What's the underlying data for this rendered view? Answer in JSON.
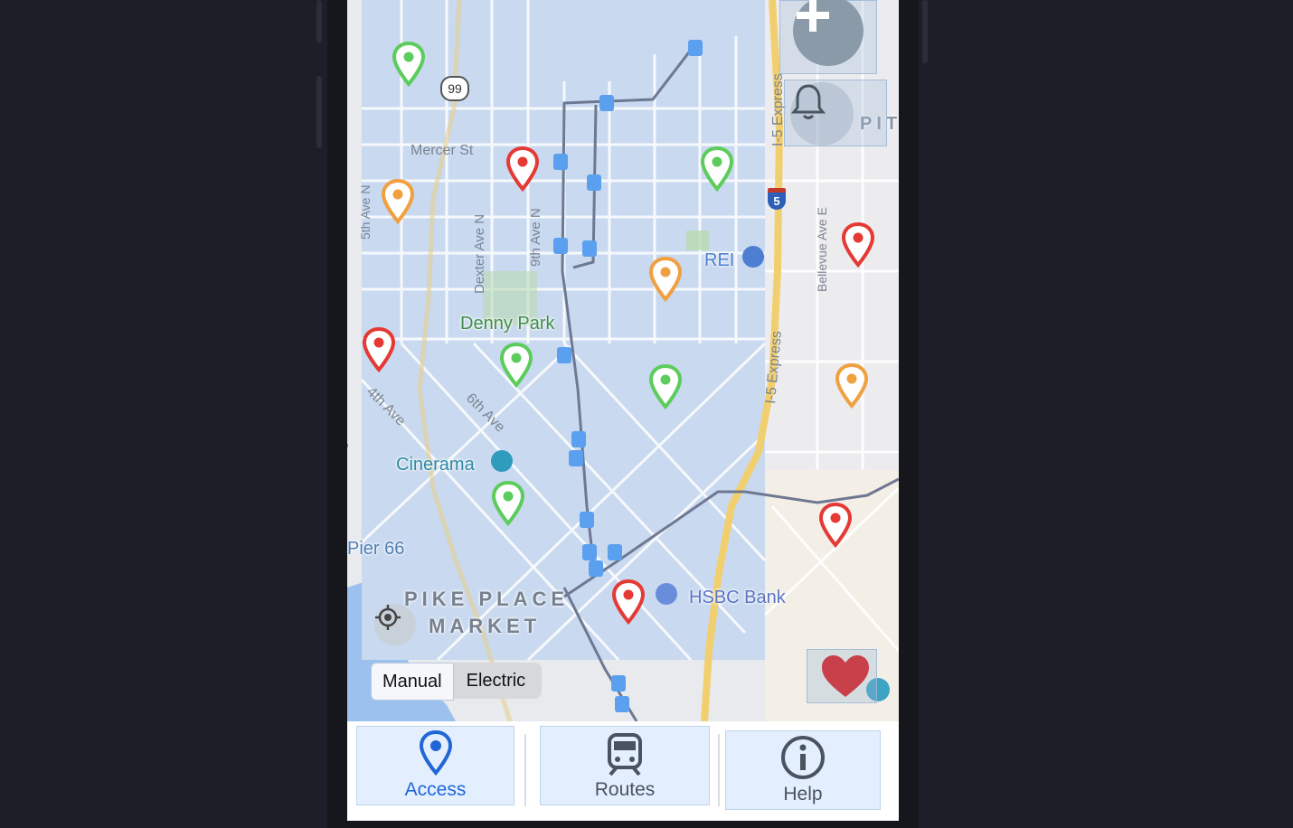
{
  "map": {
    "places": {
      "denny_park": "Denny Park",
      "rei": "REI",
      "cinerama": "Cinerama",
      "pier66": "Pier 66",
      "pike_place_line1": "PIKE PLACE",
      "pike_place_line2": "MARKET",
      "hsbc": "HSBC Bank",
      "pit": "PIT"
    },
    "streets": {
      "mercer": "Mercer St",
      "fifth_ave_n": "5th Ave N",
      "dexter": "Dexter Ave N",
      "ninth_ave_n": "9th Ave N",
      "bellevue": "Bellevue Ave E",
      "fourth_ave": "4th Ave",
      "sixth_ave": "6th Ave",
      "i5_express_top": "I-5 Express",
      "i5_express_mid": "I-5 Express",
      "highway_99": "99",
      "interstate_5": "5",
      "partial_ave": "ve"
    },
    "markers": [
      {
        "color": "green"
      },
      {
        "color": "orange"
      },
      {
        "color": "red"
      },
      {
        "color": "green"
      },
      {
        "color": "red"
      },
      {
        "color": "orange"
      },
      {
        "color": "red"
      },
      {
        "color": "green"
      },
      {
        "color": "green"
      },
      {
        "color": "orange"
      },
      {
        "color": "green"
      },
      {
        "color": "red"
      },
      {
        "color": "red"
      }
    ],
    "colors": {
      "red": "#e53935",
      "green": "#5ccc5c",
      "orange": "#f0a040"
    }
  },
  "controls": {
    "toggle": {
      "manual": "Manual",
      "electric": "Electric",
      "selected": "Electric"
    }
  },
  "tabs": [
    {
      "label": "Access",
      "icon": "map-pin-icon",
      "active": true
    },
    {
      "label": "Routes",
      "icon": "train-icon",
      "active": false
    },
    {
      "label": "Help",
      "icon": "info-icon",
      "active": false
    }
  ]
}
